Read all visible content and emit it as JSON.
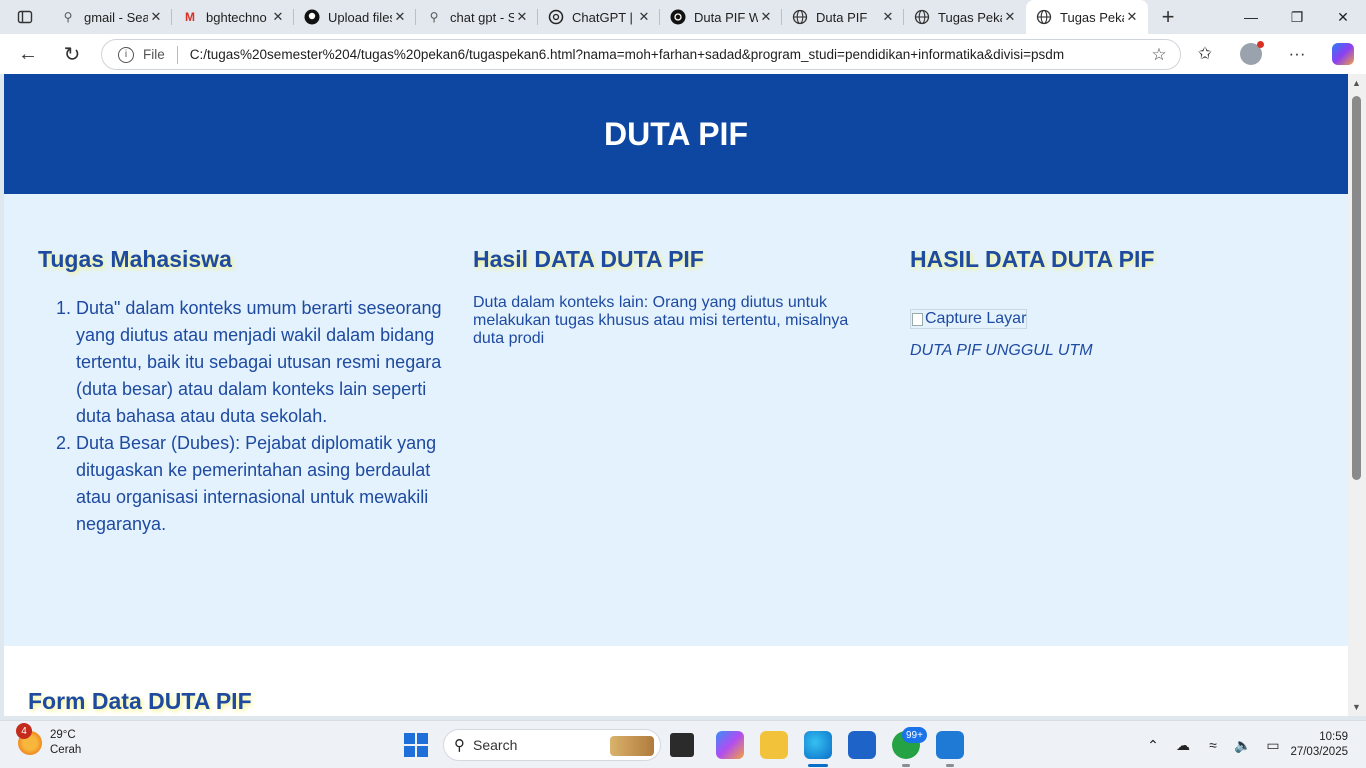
{
  "browser": {
    "tabs": [
      {
        "label": "gmail - Search",
        "icon": "search-icon"
      },
      {
        "label": "bghtechno",
        "icon": "gmail-icon"
      },
      {
        "label": "Upload files",
        "icon": "github-icon"
      },
      {
        "label": "chat gpt - Search",
        "icon": "search-icon"
      },
      {
        "label": "ChatGPT | C",
        "icon": "chatgpt-icon"
      },
      {
        "label": "Duta PIF W",
        "icon": "chatgpt-icon"
      },
      {
        "label": "Duta PIF",
        "icon": "globe-icon"
      },
      {
        "label": "Tugas Pekan",
        "icon": "globe-icon"
      },
      {
        "label": "Tugas Pekan",
        "icon": "globe-icon",
        "active": true
      }
    ],
    "address": {
      "scheme_label": "File",
      "url": "C:/tugas%20semester%204/tugas%20pekan6/tugaspekan6.html?nama=moh+farhan+sadad&program_studi=pendidikan+informatika&divisi=psdm"
    }
  },
  "page": {
    "header_title": "DUTA PIF",
    "col1": {
      "heading": "Tugas Mahasiswa",
      "items": [
        "Duta\" dalam konteks umum berarti seseorang yang diutus atau menjadi wakil dalam bidang tertentu, baik itu sebagai utusan resmi negara (duta besar) atau dalam konteks lain seperti duta bahasa atau duta sekolah.",
        "Duta Besar (Dubes): Pejabat diplomatik yang ditugaskan ke pemerintahan asing berdaulat atau organisasi internasional untuk mewakili negaranya."
      ]
    },
    "col2": {
      "heading": "Hasil DATA DUTA PIF",
      "text": "Duta dalam konteks lain: Orang yang diutus untuk melakukan tugas khusus atau misi tertentu, misalnya duta prodi"
    },
    "col3": {
      "heading": "HASIL DATA DUTA PIF",
      "image_alt": "Capture Layar",
      "caption": "DUTA PIF UNGGUL UTM"
    },
    "form_heading": "Form Data DUTA PIF"
  },
  "taskbar": {
    "weather": {
      "temp": "29°C",
      "condition": "Cerah",
      "badge": "4"
    },
    "search_label": "Search",
    "whatsapp_badge": "99+",
    "time": "10:59",
    "date": "27/03/2025"
  },
  "colors": {
    "header_bg": "#0d47a1",
    "content_bg": "#e3f2fd",
    "heading_text": "#1e4aa0",
    "heading_glow": "#f4f48a"
  }
}
